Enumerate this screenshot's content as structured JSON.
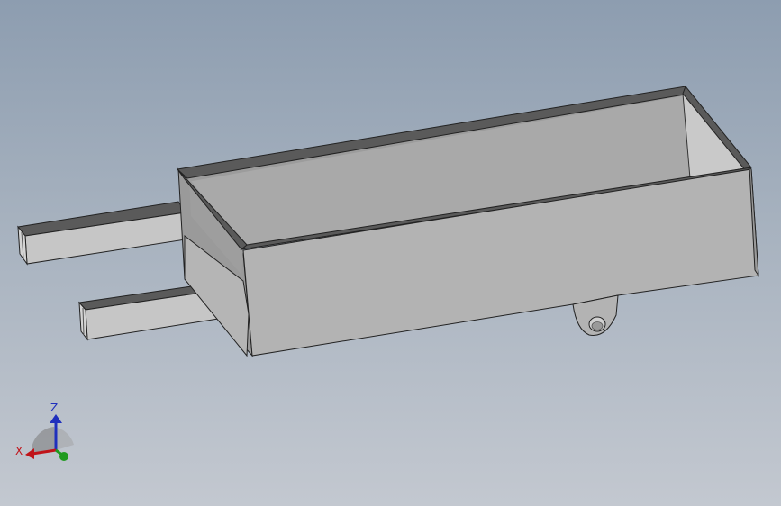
{
  "viewport": {
    "model": "wheelbarrow-tray",
    "view": "isometric",
    "render_mode": "shaded-with-edges",
    "colors": {
      "background_top": "#8d9db0",
      "background_bottom": "#c3c8d0",
      "face_light": "#c2c2c2",
      "face_mid": "#b0b0b0",
      "face_dark": "#8e8e8e",
      "edge": "#2a2a2a"
    }
  },
  "triad": {
    "x_label": "X",
    "y_label": "",
    "z_label": "Z",
    "x_color": "#c0141a",
    "y_color": "#1f9a1f",
    "z_color": "#1f2fbd"
  }
}
